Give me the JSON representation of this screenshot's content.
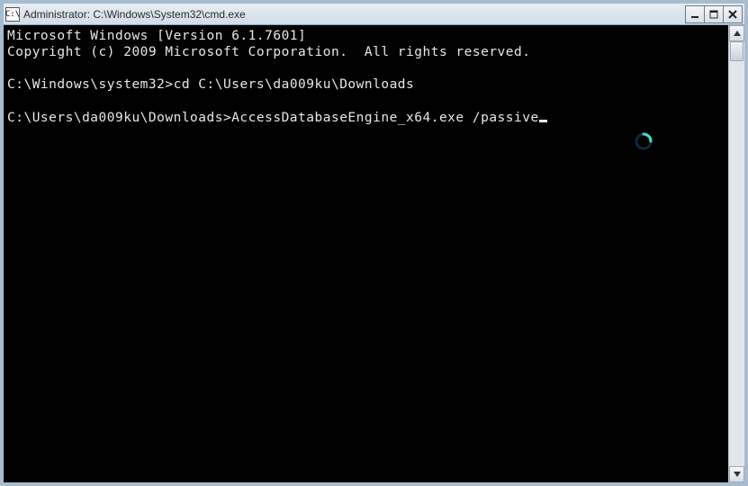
{
  "titlebar": {
    "icon_text": "C:\\",
    "title": "Administrator: C:\\Windows\\System32\\cmd.exe"
  },
  "console": {
    "line1": "Microsoft Windows [Version 6.1.7601]",
    "line2": "Copyright (c) 2009 Microsoft Corporation.  All rights reserved.",
    "blank1": "",
    "prompt1": "C:\\Windows\\system32>",
    "cmd1": "cd C:\\Users\\da009ku\\Downloads",
    "blank2": "",
    "prompt2": "C:\\Users\\da009ku\\Downloads>",
    "cmd2": "AccessDatabaseEngine_x64.exe /passive"
  }
}
